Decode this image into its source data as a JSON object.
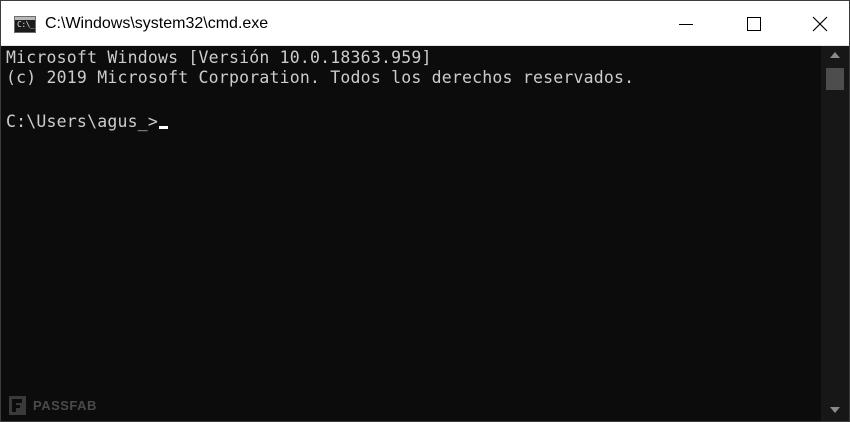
{
  "window": {
    "title": "C:\\Windows\\system32\\cmd.exe",
    "icon": "cmd-icon",
    "icon_text": "C:\\_"
  },
  "console": {
    "lines": [
      "Microsoft Windows [Versión 10.0.18363.959]",
      "(c) 2019 Microsoft Corporation. Todos los derechos reservados.",
      "",
      "C:\\Users\\agus_>"
    ],
    "prompt": "C:\\Users\\agus_>",
    "text_color": "#cccccc",
    "background_color": "#0c0c0c"
  },
  "watermark": {
    "text": "PASSFAB"
  },
  "colors": {
    "titlebar_bg": "#ffffff",
    "console_bg": "#0c0c0c",
    "scrollbar_bg": "#171717",
    "scroll_thumb": "#4d4d4d"
  }
}
